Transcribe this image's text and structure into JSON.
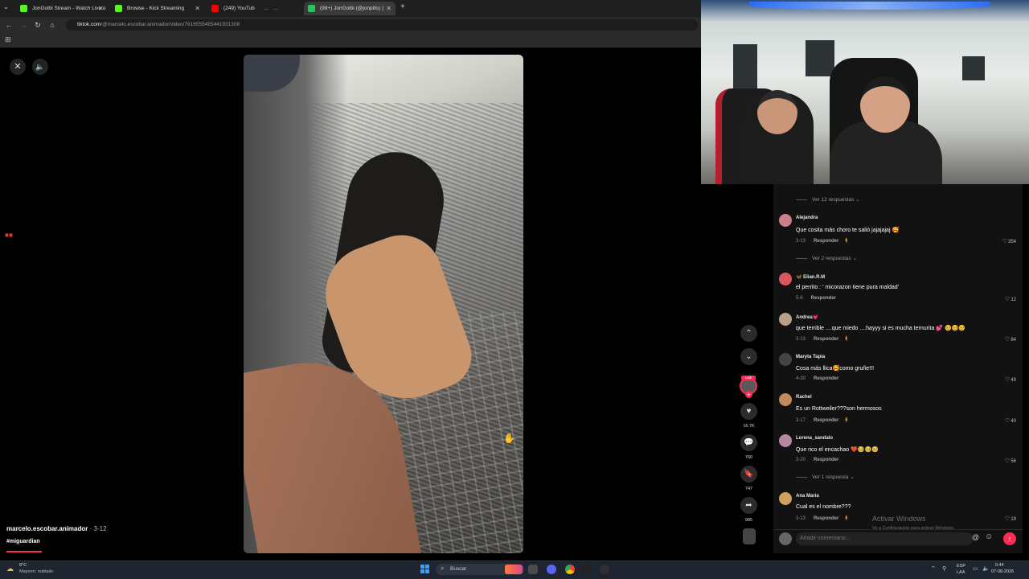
{
  "browser": {
    "tabs": [
      {
        "label": "JonGottii Stream - Watch Live o",
        "icon_color": "#53fc18",
        "active": false
      },
      {
        "label": "Browse - Kick Streaming",
        "icon_color": "#53fc18",
        "active": false
      },
      {
        "label": "(249) YouTub",
        "icon_color": "#ff0000",
        "active": false
      },
      {
        "label": "(99+) JonGottii (@jonpills) |",
        "icon_color": "#22c55e",
        "active": true
      }
    ],
    "url_domain": "tiktok.com",
    "url_path": "/@marcelo.escobar.animador/video/7616555455441931308"
  },
  "video": {
    "author": "marcelo.escobar.animador",
    "date": " · 3-12",
    "hashtag": "#miguardian",
    "close_icon": "close-icon",
    "mute_icon": "speaker-icon",
    "progress": 0.13
  },
  "actions": {
    "live_badge": "LIVE",
    "likes": "16.7K",
    "comments": "760",
    "saves": "747",
    "shares": "985"
  },
  "comments": {
    "top_replies": "Ver 12 respuestas",
    "items": [
      {
        "user": "Alejandra",
        "text": "Que cosita más choro te salió jajajajaj 🥰",
        "date": "3-13",
        "reply": "Responder",
        "likes": "354",
        "avatar": "#c9808a",
        "replies": "Ver 2 respuestas"
      },
      {
        "user": "🦋 Elian.R.M",
        "text": "el perrito : ' micorazon tiene pura maldad'",
        "date": "5-6",
        "reply": "Responder",
        "likes": "12",
        "avatar": "#d9585f",
        "replies": ""
      },
      {
        "user": "Andrea💗",
        "text": "que terrible ....que miedo ....hayyy si es mucha ternurita 💕 🥺🥺🥺",
        "date": "3-13",
        "reply": "Responder",
        "likes": "84",
        "avatar": "#b9a08a",
        "replies": ""
      },
      {
        "user": "Maryta Tapia",
        "text": "Cosa más llica🥰como gruñe!!!",
        "date": "4-30",
        "reply": "Responder",
        "likes": "49",
        "avatar": "#444444",
        "replies": ""
      },
      {
        "user": "Rachel",
        "text": "Es un Rottweiler???son hermosos",
        "date": "3-17",
        "reply": "Responder",
        "likes": "40",
        "avatar": "#c08a5a",
        "replies": ""
      },
      {
        "user": "Lorena_sandalo",
        "text": "Que rico el encachao ❤️🥺🥺🥺",
        "date": "3-20",
        "reply": "Responder",
        "likes": "56",
        "avatar": "#b58aa0",
        "replies": "Ver 1 respuesta"
      },
      {
        "user": "Ana Maria",
        "text": "Cual es el nombre???",
        "date": "3-13",
        "reply": "Responder",
        "likes": "19",
        "avatar": "#d0a060",
        "replies": ""
      }
    ],
    "input_placeholder": "Añadir comentario..."
  },
  "watermark": {
    "title": "Activar Windows",
    "subtitle": "Ve a Configuración para activar Windows."
  },
  "taskbar": {
    "temp": "8°C",
    "weather": "Mayorm. nublado",
    "search": "Buscar",
    "lang1": "ESP",
    "lang2": "LAA",
    "time": "0:44",
    "date": "07-08-2026"
  }
}
